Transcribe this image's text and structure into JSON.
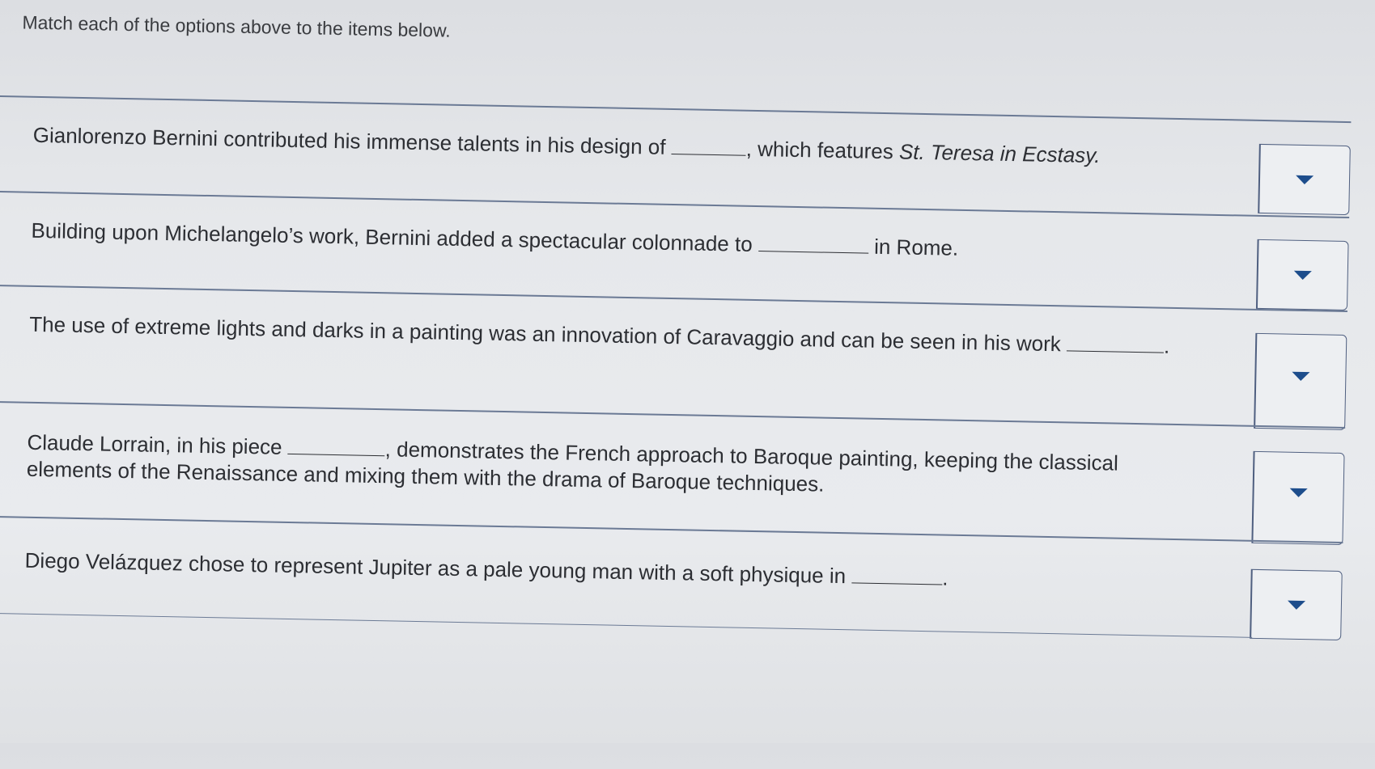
{
  "instructions": "Match each of the options above to the items below.",
  "items": [
    {
      "before": "Gianlorenzo Bernini contributed his immense talents in his design of ",
      "after": ", which features ",
      "italic": "St. Teresa in Ecstasy.",
      "tail": "",
      "selected": ""
    },
    {
      "before": "Building upon Michelangelo’s work, Bernini added a spectacular colonnade to ",
      "after": " in Rome.",
      "italic": "",
      "tail": "",
      "selected": ""
    },
    {
      "before": "The use of extreme lights and darks in a painting was an innovation of Caravaggio and can be seen in his work ",
      "after": ".",
      "italic": "",
      "tail": "",
      "selected": ""
    },
    {
      "before": "Claude Lorrain, in his piece ",
      "after": ", demonstrates the French approach to Baroque painting, keeping the classical elements of the Renaissance and mixing them with the drama of Baroque techniques.",
      "italic": "",
      "tail": "",
      "selected": ""
    },
    {
      "before": "Diego Velázquez chose to represent Jupiter as a pale young man with a soft physique in ",
      "after": ".",
      "italic": "",
      "tail": "",
      "selected": ""
    }
  ]
}
